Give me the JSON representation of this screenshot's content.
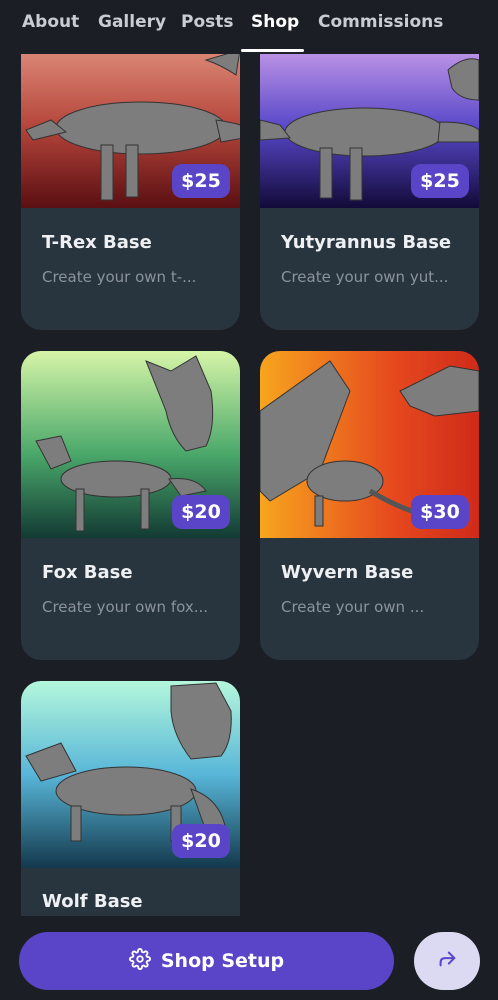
{
  "tabs": [
    {
      "label": "About"
    },
    {
      "label": "Gallery"
    },
    {
      "label": "Posts"
    },
    {
      "label": "Shop"
    },
    {
      "label": "Commissions"
    }
  ],
  "active_tab": "Shop",
  "products": [
    {
      "title": "T-Rex Base",
      "description": "Create your own t-...",
      "price": "$25",
      "image_icon": "t-rex-image"
    },
    {
      "title": "Yutyrannus Base",
      "description": "Create your own yut...",
      "price": "$25",
      "image_icon": "yutyrannus-image"
    },
    {
      "title": "Fox Base",
      "description": "Create your own fox...",
      "price": "$20",
      "image_icon": "fox-image"
    },
    {
      "title": "Wyvern Base",
      "description": "Create your own ...",
      "price": "$30",
      "image_icon": "wyvern-image"
    },
    {
      "title": "Wolf Base",
      "description": "",
      "price": "$20",
      "image_icon": "wolf-image"
    }
  ],
  "bottom_bar": {
    "shop_setup_label": "Shop Setup",
    "shop_setup_icon": "gear-icon",
    "share_icon": "share-icon"
  },
  "colors": {
    "background": "#1b1f25",
    "card": "#28343e",
    "accent": "#5a45c8",
    "share_button": "#dcdaf2"
  }
}
